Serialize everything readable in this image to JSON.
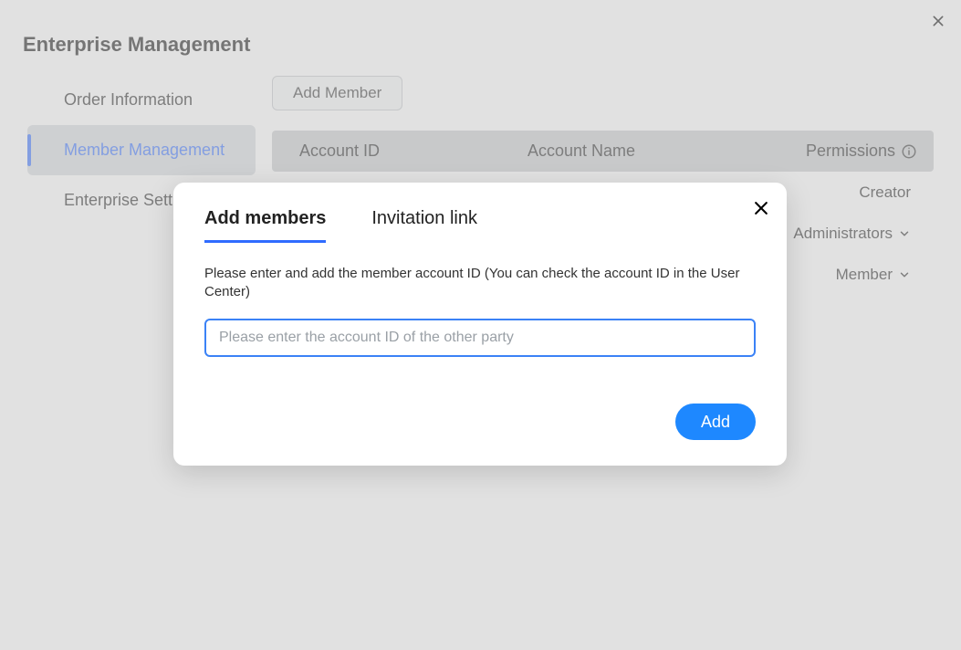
{
  "page": {
    "title": "Enterprise Management"
  },
  "sidebar": {
    "items": [
      {
        "label": "Order Information"
      },
      {
        "label": "Member Management"
      },
      {
        "label": "Enterprise Settings"
      }
    ],
    "active_index": 1
  },
  "toolbar": {
    "add_member_label": "Add Member"
  },
  "table": {
    "headers": {
      "account_id": "Account ID",
      "account_name": "Account Name",
      "permissions": "Permissions"
    },
    "rows": [
      {
        "permission": "Creator",
        "has_dropdown": false
      },
      {
        "permission": "Administrators",
        "has_dropdown": true
      },
      {
        "permission": "Member",
        "has_dropdown": true
      }
    ]
  },
  "modal": {
    "tabs": {
      "add_members": "Add members",
      "invitation_link": "Invitation link"
    },
    "active_tab": "add_members",
    "description": "Please enter and add the member account ID (You can check the account ID in the User Center)",
    "input_placeholder": "Please enter the account ID of the other party",
    "input_value": "",
    "add_button": "Add"
  }
}
